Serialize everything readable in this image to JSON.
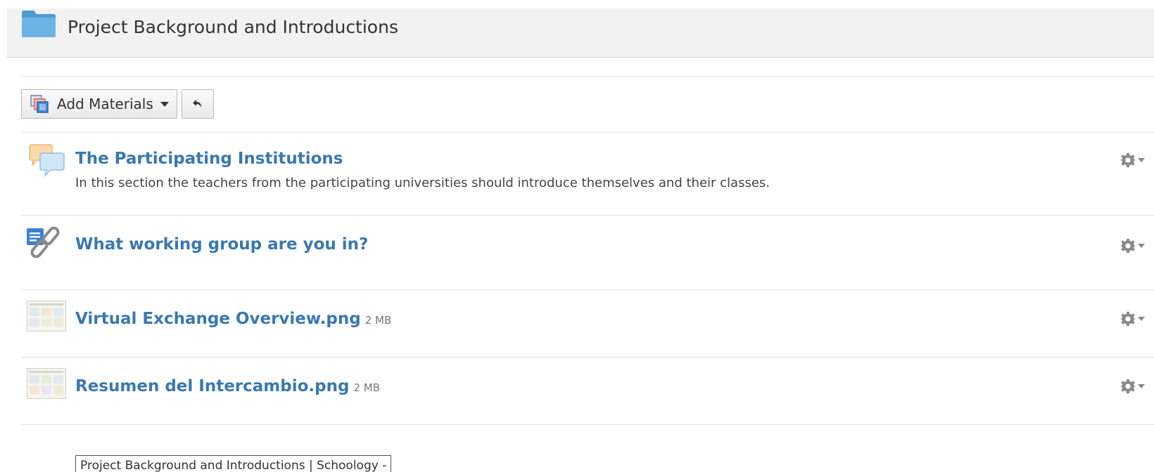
{
  "folder": {
    "title": "Project Background and Introductions",
    "icon": "folder-icon",
    "color": "#5fa8dc"
  },
  "toolbar": {
    "add_materials_label": "Add Materials",
    "add_materials_icon": "materials-icon",
    "undo_icon": "undo-arrow-icon"
  },
  "items": [
    {
      "title": "The Participating Institutions",
      "description": "In this section the teachers from the participating universities should introduce themselves and their classes.",
      "icon": "discussion-bubbles-icon"
    },
    {
      "title": "What working group are you in?",
      "icon": "page-link-icon"
    },
    {
      "title": "Virtual Exchange Overview.png",
      "size": "2 MB",
      "icon": "image-thumbnail"
    },
    {
      "title": "Resumen del Intercambio.png",
      "size": "2 MB",
      "icon": "image-thumbnail"
    }
  ],
  "tooltip": {
    "text": "Project Background and Introductions | Schoology -"
  },
  "colors": {
    "link": "#3a78b0",
    "header_bg": "#f2f2f2"
  }
}
